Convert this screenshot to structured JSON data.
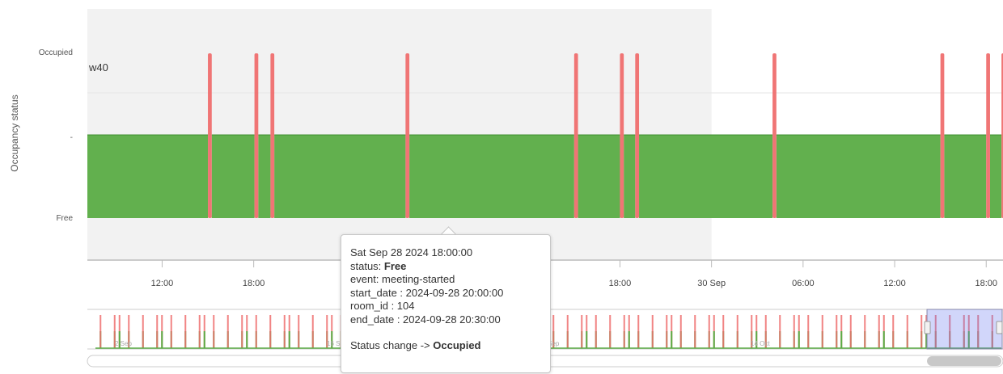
{
  "chart_data": {
    "type": "area",
    "ylabel": "Occupancy status",
    "y_categories": [
      "Free",
      "-",
      "Occupied"
    ],
    "week_label": "w40",
    "x_tick_labels": [
      "12:00",
      "18:00",
      "2",
      "18:00",
      "30 Sep",
      "06:00",
      "12:00",
      "18:00"
    ],
    "x_tick_hours": [
      12,
      18,
      24,
      42,
      48,
      54,
      60,
      66
    ],
    "view_range_hours": [
      7.1,
      67.1
    ],
    "shaded_until_hours": 48,
    "occupied_intervals_hours": [
      [
        15.0,
        15.25
      ],
      [
        18.05,
        18.3
      ],
      [
        19.1,
        19.35
      ],
      [
        27.95,
        28.2
      ],
      [
        39.0,
        39.25
      ],
      [
        42.0,
        42.25
      ],
      [
        43.0,
        43.25
      ],
      [
        52.0,
        52.25
      ],
      [
        63.0,
        63.25
      ],
      [
        66.0,
        66.25
      ],
      [
        67.0,
        67.25
      ]
    ],
    "colors": {
      "free": "#5aac45",
      "occupied": "#ef6e6e"
    }
  },
  "navigator": {
    "labels": [
      "2 Sep",
      "16 Sep",
      "30 Sep",
      "14 Oct"
    ],
    "bar_count": 64,
    "selection_fraction": [
      0.917,
      1.0
    ],
    "scrollbar_fraction": [
      0.917,
      1.0
    ]
  },
  "tooltip": {
    "date": "Sat Sep 28 2024 18:00:00",
    "status_label": "status: ",
    "status_value": "Free",
    "event": "event: meeting-started",
    "start": "start_date : 2024-09-28 20:00:00",
    "room": "room_id : 104",
    "end": "end_date : 2024-09-28 20:30:00",
    "change_label": "Status change -> ",
    "change_value": "Occupied"
  }
}
